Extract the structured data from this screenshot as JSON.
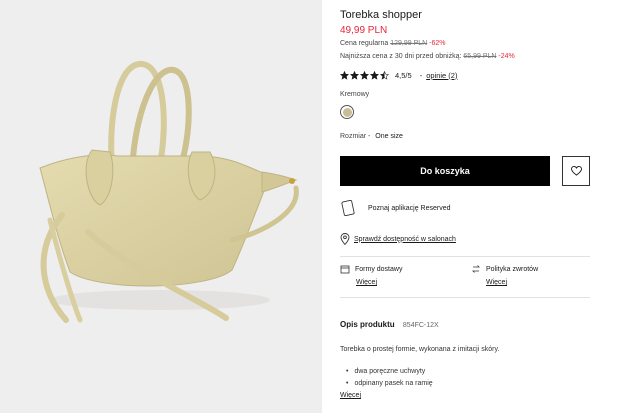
{
  "product": {
    "title": "Torebka shopper",
    "price": "49,99 PLN",
    "regular_label": "Cena regularna",
    "regular_price": "129,99 PLN",
    "regular_discount": "-62%",
    "lowest_label": "Najniższa cena z 30 dni przed obniżką:",
    "lowest_price": "65,99 PLN",
    "lowest_discount": "-24%",
    "rating_text": "4,5/5",
    "rating_value": 4.5,
    "rating_max": 5,
    "rating_separator": "-",
    "reviews_link": "opinie (2)"
  },
  "color": {
    "label": "Kremowy",
    "swatch_hex": "#c9bd95"
  },
  "size": {
    "label": "Rozmiar -",
    "value": "One size"
  },
  "actions": {
    "add_to_cart": "Do koszyka",
    "favorite_icon": "heart-icon"
  },
  "app_promo": {
    "text": "Poznaj aplikację Reserved",
    "icon": "phone-icon"
  },
  "store_check": {
    "text": "Sprawdź dostępność w salonach",
    "icon": "location-pin-icon"
  },
  "delivery": {
    "label": "Formy dostawy",
    "link": "Więcej",
    "icon": "delivery-box-icon"
  },
  "returns": {
    "label": "Polityka zwrotów",
    "link": "Więcej",
    "icon": "return-arrow-icon"
  },
  "description": {
    "heading": "Opis produktu",
    "code": "854FC-12X",
    "text": "Torebka o prostej formie, wykonana z imitacji skóry.",
    "bullets": [
      "dwa poręczne uchwyty",
      "odpinany pasek na ramię"
    ],
    "more_link": "Więcej"
  },
  "colors": {
    "price_red": "#e5263b",
    "button_black": "#000000",
    "bag": "#d8ce9f",
    "photo_bg": "#efeeee"
  }
}
